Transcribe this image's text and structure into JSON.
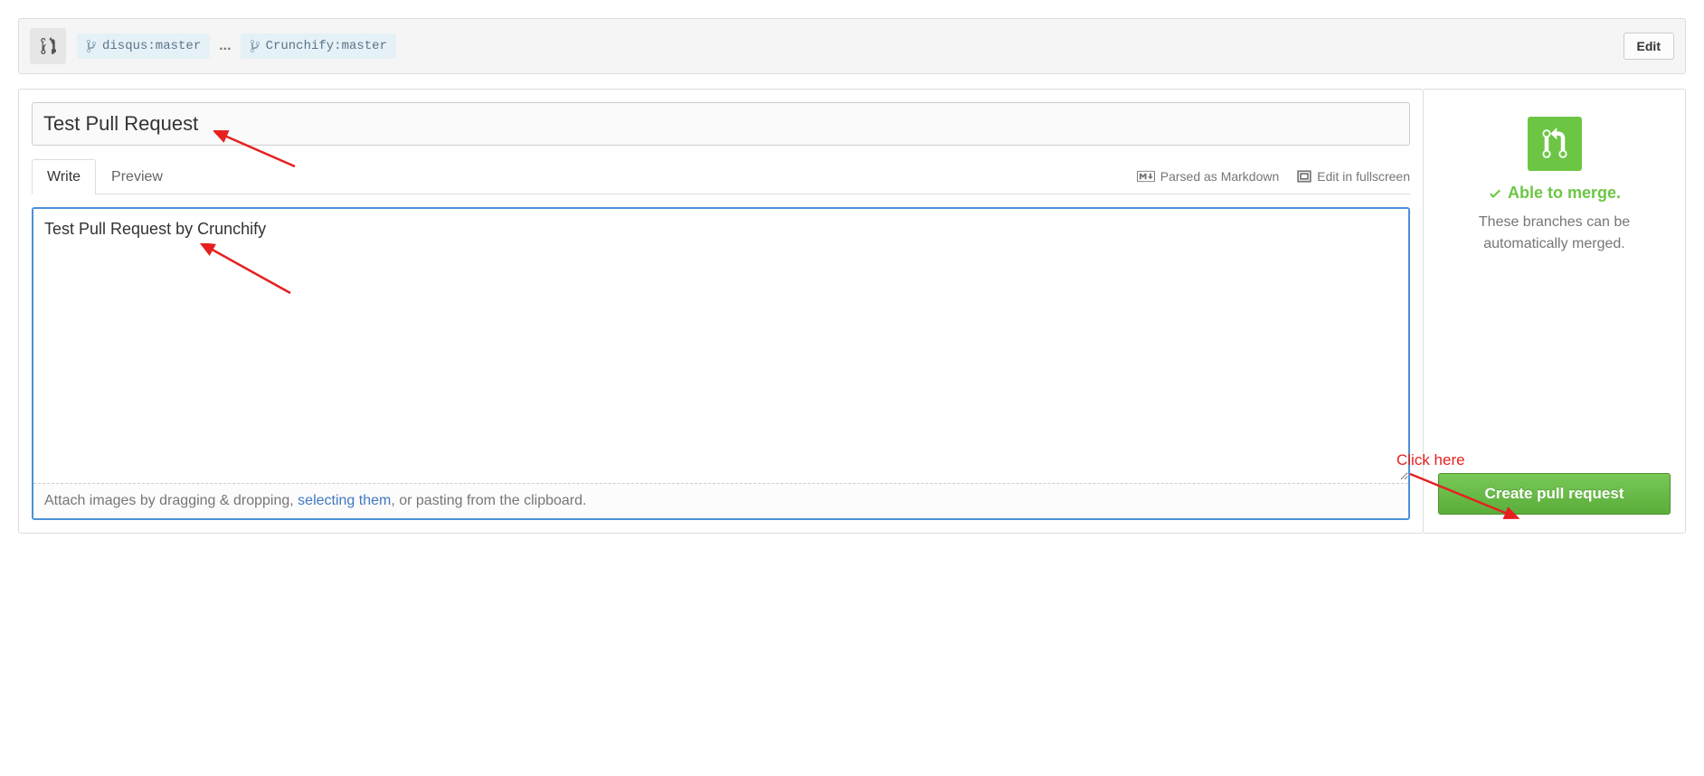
{
  "compare": {
    "base_branch": "disqus:master",
    "head_branch": "Crunchify:master",
    "dots": "...",
    "edit_label": "Edit"
  },
  "form": {
    "title_value": "Test Pull Request",
    "tabs": {
      "write": "Write",
      "preview": "Preview"
    },
    "meta": {
      "markdown": "Parsed as Markdown",
      "fullscreen": "Edit in fullscreen"
    },
    "body_value": "Test Pull Request by Crunchify",
    "attach_prefix": "Attach images by dragging & dropping, ",
    "attach_link": "selecting them",
    "attach_suffix": ", or pasting from the clipboard."
  },
  "sidebar": {
    "status": "Able to merge.",
    "desc": "These branches can be automatically merged.",
    "create_label": "Create pull request"
  },
  "annotations": {
    "click_here": "Click here"
  }
}
